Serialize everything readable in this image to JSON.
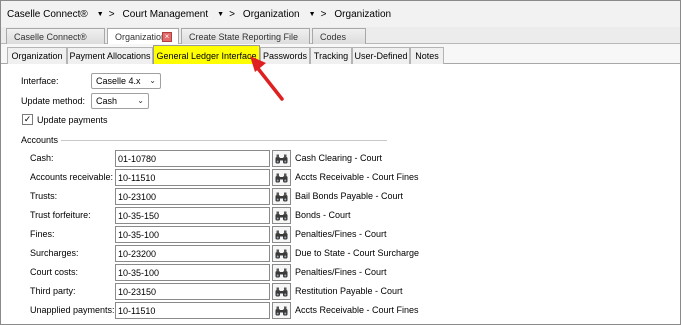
{
  "breadcrumb": {
    "items": [
      "Caselle Connect®",
      "Court Management",
      "Organization",
      "Organization"
    ],
    "separator_arrow": "▼",
    "separator_text": ">"
  },
  "doc_tabs": [
    {
      "label": "Caselle Connect®",
      "active": false
    },
    {
      "label": "Organization",
      "active": true,
      "closable": true
    },
    {
      "label": "Create State Reporting File",
      "active": false
    },
    {
      "label": "Codes",
      "active": false
    }
  ],
  "sub_tabs": [
    {
      "label": "Organization",
      "active": false
    },
    {
      "label": "Payment Allocations",
      "active": false
    },
    {
      "label": "General Ledger Interface",
      "active": true
    },
    {
      "label": "Passwords",
      "active": false
    },
    {
      "label": "Tracking",
      "active": false
    },
    {
      "label": "User-Defined",
      "active": false
    },
    {
      "label": "Notes",
      "active": false
    }
  ],
  "form": {
    "interface_label": "Interface:",
    "interface_value": "Caselle 4.x",
    "update_method_label": "Update method:",
    "update_method_value": "Cash",
    "update_payments_label": "Update payments",
    "update_payments_checked": true
  },
  "accounts": {
    "title": "Accounts",
    "rows": [
      {
        "label": "Cash:",
        "account": "01-10780",
        "description": "Cash Clearing - Court"
      },
      {
        "label": "Accounts receivable:",
        "account": "10-11510",
        "description": "Accts Receivable - Court Fines"
      },
      {
        "label": "Trusts:",
        "account": "10-23100",
        "description": "Bail Bonds Payable - Court"
      },
      {
        "label": "Trust forfeiture:",
        "account": "10-35-150",
        "description": "Bonds - Court"
      },
      {
        "label": "Fines:",
        "account": "10-35-100",
        "description": "Penalties/Fines - Court"
      },
      {
        "label": "Surcharges:",
        "account": "10-23200",
        "description": "Due to State - Court Surcharge"
      },
      {
        "label": "Court costs:",
        "account": "10-35-100",
        "description": "Penalties/Fines - Court"
      },
      {
        "label": "Third party:",
        "account": "10-23150",
        "description": "Restitution Payable - Court"
      },
      {
        "label": "Unapplied payments:",
        "account": "10-11510",
        "description": "Accts Receivable - Court Fines"
      }
    ]
  },
  "colors": {
    "active_subtab_highlight": "#ffff00",
    "annotation_arrow": "#e02020"
  },
  "icons": {
    "lookup": "binoculars-icon",
    "close": "close-icon",
    "dropdown": "chevron-down-icon",
    "checkbox": "checkmark-icon"
  }
}
